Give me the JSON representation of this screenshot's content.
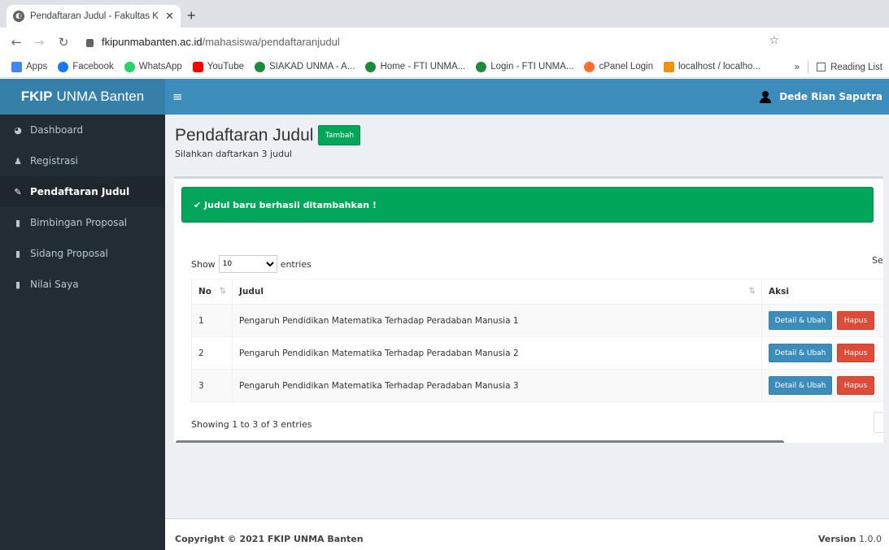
{
  "browser": {
    "tab_title": "Pendaftaran Judul - Fakultas K",
    "url_host": "fkipunmabanten.ac.id",
    "url_path": "/mahasiswa/pendaftaranjudul",
    "bookmarks": [
      {
        "label": "Apps",
        "color": "#4285f4"
      },
      {
        "label": "Facebook",
        "color": "#1877f2"
      },
      {
        "label": "WhatsApp",
        "color": "#25d366"
      },
      {
        "label": "YouTube",
        "color": "#ff0000"
      },
      {
        "label": "SIAKAD UNMA - A...",
        "color": "#1e8a3c"
      },
      {
        "label": "Home - FTI UNMA...",
        "color": "#1e8a3c"
      },
      {
        "label": "Login - FTI UNMA...",
        "color": "#1e8a3c"
      },
      {
        "label": "cPanel Login",
        "color": "#ff6c2c"
      },
      {
        "label": "localhost / localho...",
        "color": "#f29111"
      }
    ],
    "reading_list": "Reading List",
    "more": "»"
  },
  "navbar": {
    "brand_bold": "FKIP",
    "brand_rest": "UNMA Banten",
    "user_name": "Dede Rian Saputra",
    "color": "#3c8dbc"
  },
  "sidebar": {
    "items": [
      {
        "label": "Dashboard",
        "icon": "dashboard-icon"
      },
      {
        "label": "Registrasi",
        "icon": "user-icon"
      },
      {
        "label": "Pendaftaran Judul",
        "icon": "edit-icon"
      },
      {
        "label": "Bimbingan Proposal",
        "icon": "file-icon"
      },
      {
        "label": "Sidang Proposal",
        "icon": "file-icon"
      },
      {
        "label": "Nilai Saya",
        "icon": "file-icon"
      }
    ]
  },
  "page": {
    "title": "Pendaftaran Judul",
    "add_button": "Tambah",
    "subtitle": "Silahkan daftarkan 3 judul",
    "alert": "✔ Judul baru berhasil ditambahkan !",
    "show_label": "Show",
    "entries_label": "entries",
    "page_length": "10",
    "search_label": "Search:",
    "info": "Showing 1 to 3 of 3 entries"
  },
  "table": {
    "headers": [
      "No",
      "Judul",
      "Aksi"
    ],
    "rows": [
      {
        "no": "1",
        "judul": "Pengaruh Pendidikan Matematika Terhadap Peradaban Manusia 1"
      },
      {
        "no": "2",
        "judul": "Pengaruh Pendidikan Matematika Terhadap Peradaban Manusia 2"
      },
      {
        "no": "3",
        "judul": "Pengaruh Pendidikan Matematika Terhadap Peradaban Manusia 3"
      }
    ],
    "detail_label": "Detail & Ubah",
    "delete_label": "Hapus"
  },
  "footer": {
    "copyright": "Copyright © 2021 FKIP UNMA Banten",
    "version_label": "Version",
    "version": "1.0.0"
  }
}
